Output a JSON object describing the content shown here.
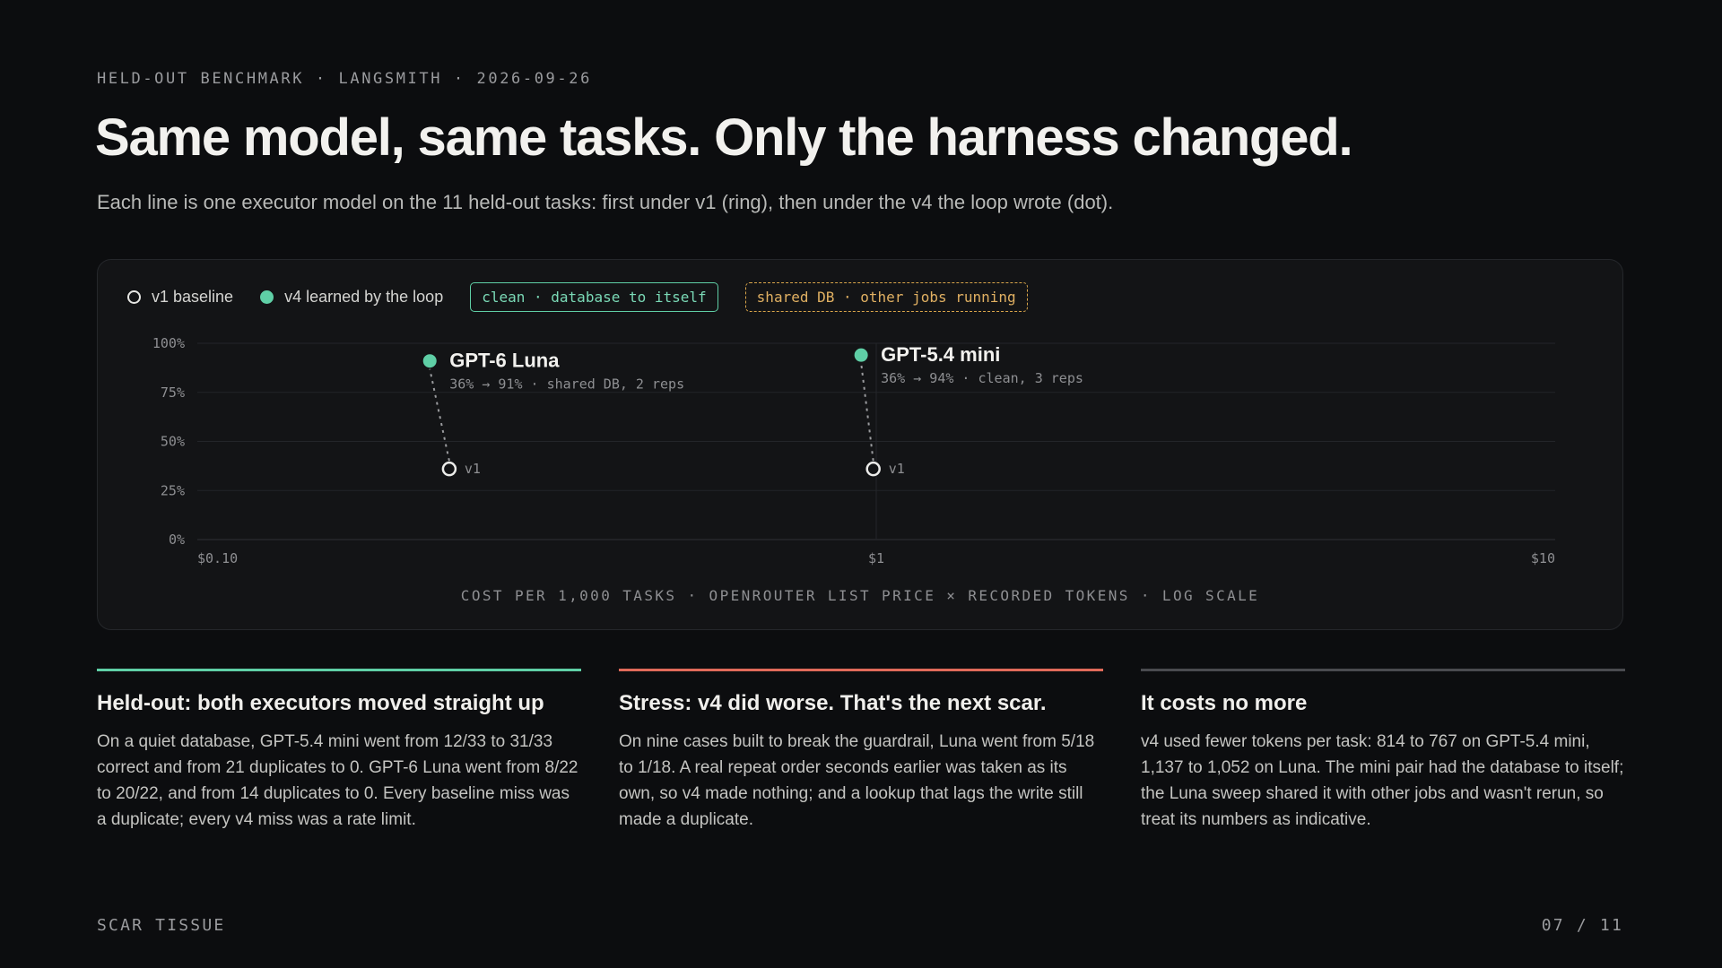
{
  "eyebrow": "HELD-OUT BENCHMARK · LANGSMITH · 2026-09-26",
  "title": "Same model, same tasks. Only the harness changed.",
  "subtitle": "Each line is one executor model on the 11 held-out tasks: first under v1 (ring), then under the v4 the loop wrote (dot).",
  "legend": {
    "v1": "v1 baseline",
    "v4": "v4 learned by the loop",
    "tag_clean": "clean · database to itself",
    "tag_shared": "shared DB · other jobs running"
  },
  "colors": {
    "accent_green": "#5fcfa6",
    "accent_red": "#e06a5a",
    "neutral": "#4a4b4f",
    "shared_amber": "#d9a54a"
  },
  "chart_data": {
    "type": "scatter",
    "xlabel": "COST PER 1,000 TASKS · OPENROUTER LIST PRICE × RECORDED TOKENS · LOG SCALE",
    "ylabel": "",
    "x_scale": "log",
    "xlim": [
      0.1,
      10
    ],
    "ylim": [
      0,
      100
    ],
    "x_ticks": [
      {
        "value": 0.1,
        "label": "$0.10"
      },
      {
        "value": 1,
        "label": "$1"
      },
      {
        "value": 10,
        "label": "$10"
      }
    ],
    "y_ticks": [
      {
        "value": 0,
        "label": "0%"
      },
      {
        "value": 25,
        "label": "25%"
      },
      {
        "value": 50,
        "label": "50%"
      },
      {
        "value": 75,
        "label": "75%"
      },
      {
        "value": 100,
        "label": "100%"
      }
    ],
    "grid": true,
    "series": [
      {
        "name": "GPT-6 Luna",
        "note": "36% → 91% · shared DB, 2 reps",
        "v1": {
          "x": 0.235,
          "y": 36,
          "label": "v1"
        },
        "v4": {
          "x": 0.22,
          "y": 91
        }
      },
      {
        "name": "GPT-5.4 mini",
        "note": "36% → 94% · clean, 3 reps",
        "v1": {
          "x": 0.99,
          "y": 36,
          "label": "v1"
        },
        "v4": {
          "x": 0.95,
          "y": 94
        }
      }
    ]
  },
  "columns": [
    {
      "heading": "Held-out: both executors moved straight up",
      "body": "On a quiet database, GPT-5.4 mini went from 12/33 to 31/33 correct and from 21 duplicates to 0. GPT-6 Luna went from 8/22 to 20/22, and from 14 duplicates to 0. Every baseline miss was a duplicate; every v4 miss was a rate limit."
    },
    {
      "heading": "Stress: v4 did worse. That's the next scar.",
      "body": "On nine cases built to break the guardrail, Luna went from 5/18 to 1/18. A real repeat order seconds earlier was taken as its own, so v4 made nothing; and a lookup that lags the write still made a duplicate."
    },
    {
      "heading": "It costs no more",
      "body": "v4 used fewer tokens per task: 814 to 767 on GPT-5.4 mini, 1,137 to 1,052 on Luna. The mini pair had the database to itself; the Luna sweep shared it with other jobs and wasn't rerun, so treat its numbers as indicative."
    }
  ],
  "footer": {
    "left": "SCAR TISSUE",
    "right": "07 / 11"
  }
}
